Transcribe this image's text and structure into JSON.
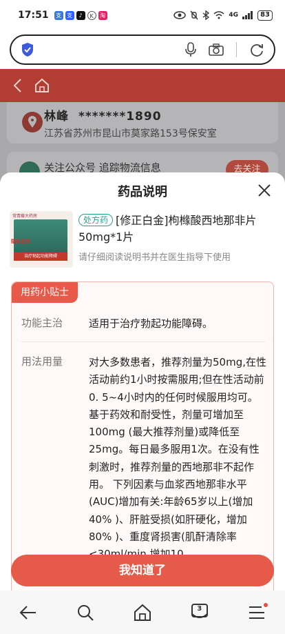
{
  "status_bar": {
    "time": "17:51",
    "battery": "83",
    "network": "4G"
  },
  "browser": {
    "url_placeholder": ""
  },
  "background_page": {
    "recipient_name": "林峰",
    "recipient_phone": "*******1890",
    "address": "江苏省苏州市昆山市莫家路153号保安室",
    "follow_text": "关注公众号 追踪物流信息",
    "follow_button": "去关注"
  },
  "sheet": {
    "title": "药品说明",
    "product": {
      "badge": "处方药",
      "name": "[修正白金]枸橼酸西地那非片 50mg*1片",
      "tip": "请仔细阅读说明书并在医生指导下使用",
      "image_top_text": "常青藤大药房",
      "image_privacy": "隐私发货",
      "image_band": "治疗勃起功能障碍"
    },
    "tips": {
      "tag": "用药小贴士",
      "rows": [
        {
          "label": "功能主治",
          "value": "适用于治疗勃起功能障碍。"
        },
        {
          "label": "用法用量",
          "value": "对大多数患者，推荐剂量为50mg,在性活动前约1小时按需服用;但在性活动前0. 5~4小时内的任何时候服用均可。基于药效和耐受性，剂量可增加至100mg (最大推荐剂量)或降低至25mg。每日最多服用1次。在没有性刺激时，推荐剂量的西地那非不起作用。 下列因素与血浆西地那非水平(AUC)增加有关:年龄65岁以上(增加40% )、肝脏受损(如肝硬化，增加80% )、重度肾损害(肌酐清除率<30ml/min,增加10"
        }
      ]
    },
    "ok_button": "我知道了"
  },
  "bottom_nav": {
    "tab_count": "3"
  }
}
